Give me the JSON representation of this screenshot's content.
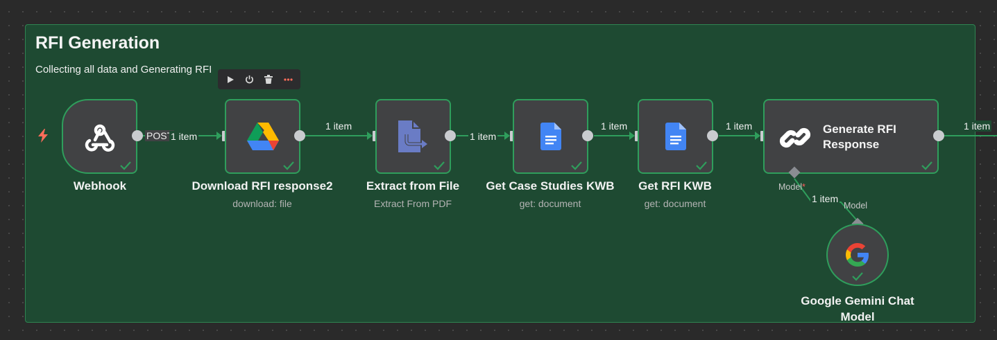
{
  "sticky": {
    "title": "RFI Generation",
    "subtitle": "Collecting all data and Generating RFI"
  },
  "nodes": {
    "webhook": {
      "label": "Webhook",
      "icon": "webhook-icon",
      "status": "success"
    },
    "drive": {
      "label": "Download RFI response2",
      "sublabel": "download: file",
      "icon": "google-drive-icon",
      "status": "success"
    },
    "extract": {
      "label": "Extract from File",
      "sublabel": "Extract From PDF",
      "icon": "file-extract-icon",
      "status": "success"
    },
    "case_studies": {
      "label": "Get Case Studies KWB",
      "sublabel": "get: document",
      "icon": "google-docs-icon",
      "status": "success"
    },
    "rfi_kwb": {
      "label": "Get RFI KWB",
      "sublabel": "get: document",
      "icon": "google-docs-icon",
      "status": "success"
    },
    "generate": {
      "label": "Generate RFI Response",
      "icon": "chain-link-icon",
      "status": "success",
      "port_label": "Model",
      "port_required_mark": "*"
    },
    "gemini": {
      "label": "Google Gemini Chat Model",
      "icon": "google-g-icon",
      "status": "success",
      "port_label": "Model"
    }
  },
  "edges": {
    "webhook_out": "POST",
    "webhook_drive": "1 item",
    "drive_extract": "1 item",
    "extract_case": "1 item",
    "case_rfi": "1 item",
    "rfi_generate": "1 item",
    "generate_out": "1 item",
    "gemini_generate": "1 item"
  },
  "toolbar": {
    "actions": [
      "play-icon",
      "power-icon",
      "trash-icon",
      "more-icon"
    ]
  },
  "colors": {
    "canvas": "#2a2a2a",
    "sticky_bg": "#1e4a32",
    "node_bg": "#414244",
    "success": "#2f9e5c",
    "trigger_bolt": "#ff6d5a"
  }
}
